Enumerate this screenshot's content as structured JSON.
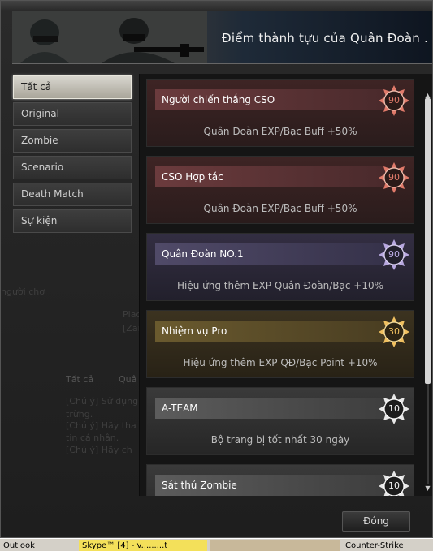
{
  "banner": {
    "title": "Điểm thành tựu của Quân Đoàn ."
  },
  "tabs": [
    {
      "label": "Tất cả",
      "active": true
    },
    {
      "label": "Original"
    },
    {
      "label": "Zombie"
    },
    {
      "label": "Scenario"
    },
    {
      "label": "Death Match"
    },
    {
      "label": "Sự kiện"
    }
  ],
  "achievements": [
    {
      "name": "Người chiến thắng CSO",
      "desc": "Quân Đoàn EXP/Bạc Buff +50%",
      "points": "90",
      "color": "red"
    },
    {
      "name": "CSO Hợp tác",
      "desc": "Quân Đoàn EXP/Bạc Buff +50%",
      "points": "90",
      "color": "red"
    },
    {
      "name": "Quân Đoàn NO.1",
      "desc": "Hiệu ứng thêm EXP Quân Đoàn/Bạc +10%",
      "points": "90",
      "color": "violet"
    },
    {
      "name": "Nhiệm vụ Pro",
      "desc": "Hiệu ứng thêm EXP QĐ/Bạc Point +10%",
      "points": "30",
      "color": "gold"
    },
    {
      "name": "A-TEAM",
      "desc": "Bộ trang bị  tốt nhất 30 ngày",
      "points": "10",
      "color": "gray"
    },
    {
      "name": "Sát thủ Zombie",
      "desc": "",
      "points": "10",
      "color": "gray"
    }
  ],
  "close_button": "Đóng",
  "background_text": {
    "left": "người chơ",
    "tab1": "Tất cả",
    "tab2": "Quâ",
    "line1": "[Chú ý] Sử dụng",
    "line2": "trừng.",
    "line3": "[Chú ý] Hãy tha",
    "line4": "tin cá nhân.",
    "line5": "[Chú ý] Hãy ch",
    "box1": "Place",
    "box2": "[Zam"
  },
  "taskbar": [
    {
      "label": "Outlook"
    },
    {
      "label": "Skype™ [4] - v.........t"
    },
    {
      "label": ""
    },
    {
      "label": "Counter-Strike"
    }
  ],
  "colors": {
    "red_medal": "#e07a6a",
    "violet_medal": "#b8a8e0",
    "gold_medal": "#f0c060",
    "gray_medal": "#e8e8e8",
    "active_tab": "#d0cdc4"
  }
}
